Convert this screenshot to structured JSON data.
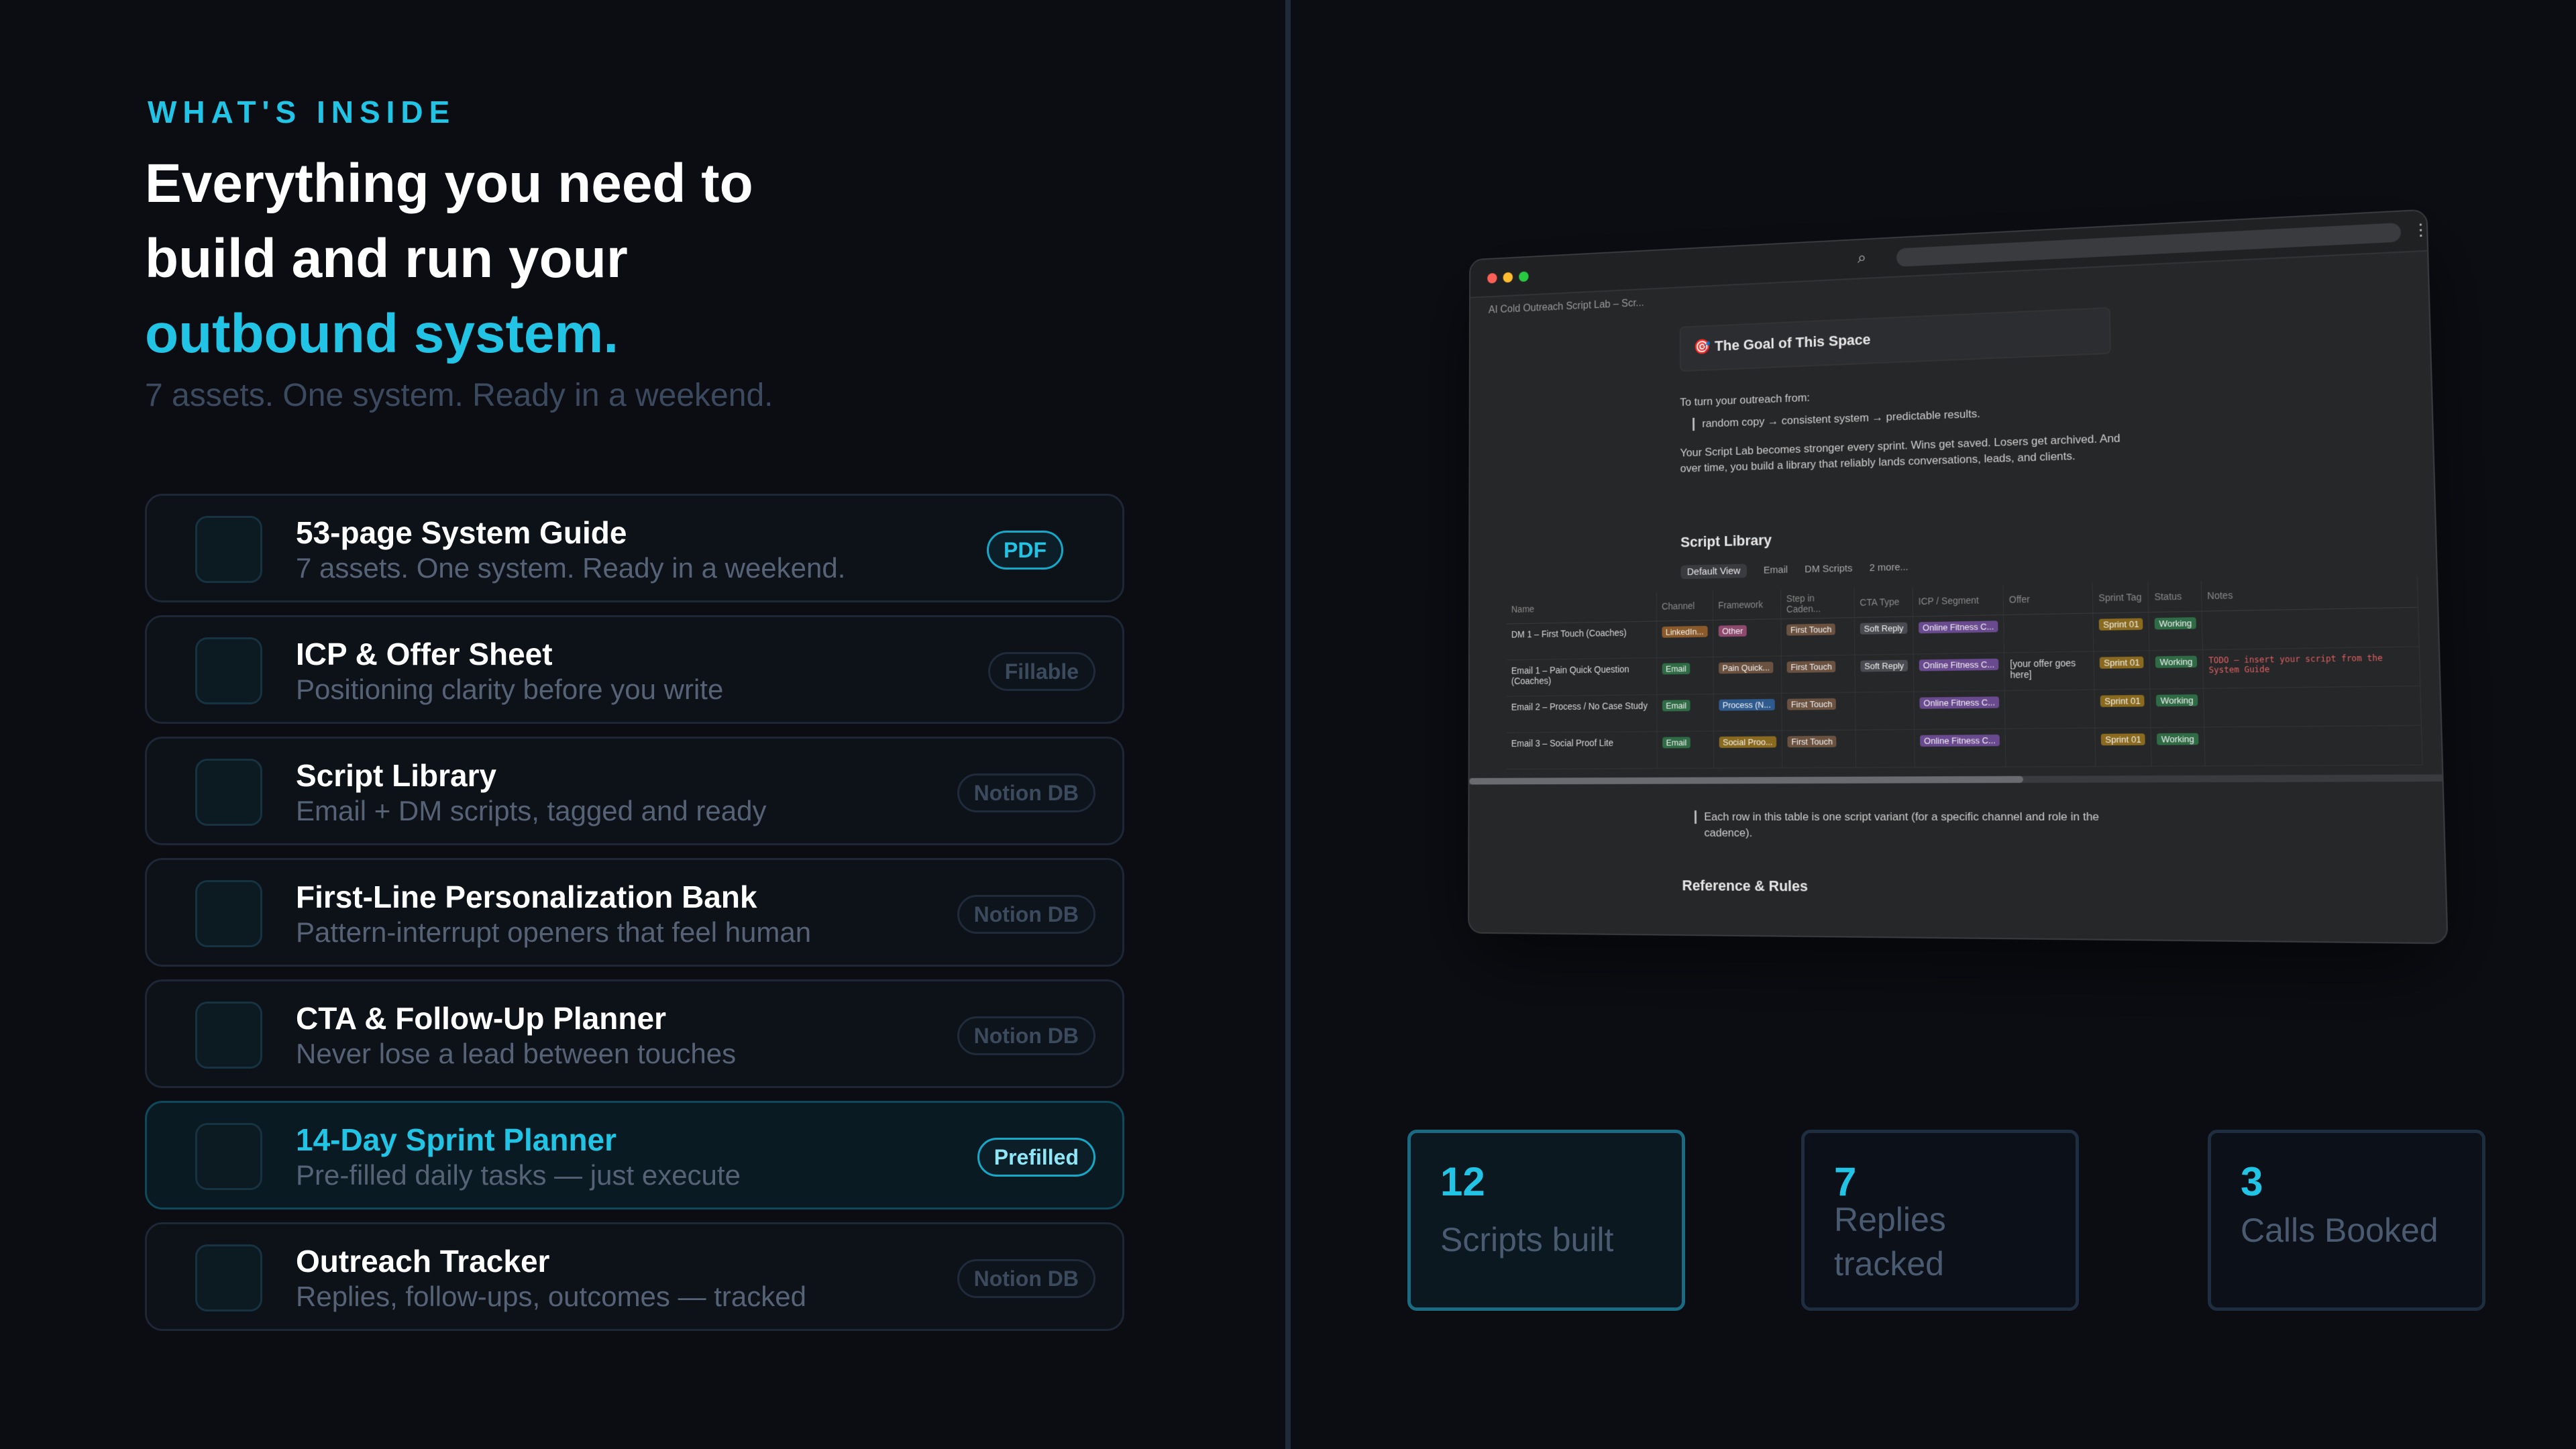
{
  "hero": {
    "eyebrow": "WHAT'S INSIDE",
    "headline_line1": "Everything you need to",
    "headline_line2": "build and run your",
    "headline_accent": "outbound system.",
    "subtitle": "7 assets. One system. Ready in a weekend."
  },
  "assets": [
    {
      "title": "53-page System Guide",
      "desc": "7 assets. One system. Ready in a weekend.",
      "badge": "PDF"
    },
    {
      "title": "ICP & Offer Sheet",
      "desc": "Positioning clarity before you write",
      "badge": "Fillable"
    },
    {
      "title": "Script Library",
      "desc": "Email + DM scripts, tagged and ready",
      "badge": "Notion DB"
    },
    {
      "title": "First-Line Personalization Bank",
      "desc": "Pattern-interrupt openers that feel human",
      "badge": "Notion DB"
    },
    {
      "title": "CTA & Follow-Up Planner",
      "desc": "Never lose a lead between touches",
      "badge": "Notion DB"
    },
    {
      "title": "14-Day Sprint Planner",
      "desc": "Pre-filled daily tasks — just execute",
      "badge": "Prefilled"
    },
    {
      "title": "Outreach Tracker",
      "desc": "Replies, follow-ups, outcomes — tracked",
      "badge": "Notion DB"
    }
  ],
  "window": {
    "tab_label": "AI Cold Outreach Script Lab – Scr...",
    "callout_title": "🎯 The Goal of This Space",
    "intro": "To turn your outreach from:",
    "quote": "random copy → consistent system → predictable results.",
    "para_line1": "Your Script Lab becomes stronger every sprint. Wins get saved. Losers get archived. And",
    "para_line2": "over time, you build a library that reliably lands conversations, leads, and clients.",
    "library_heading": "Script Library",
    "views": {
      "default": "Default View",
      "email": "Email",
      "dm": "DM Scripts",
      "more": "2 more..."
    },
    "columns": [
      "Name",
      "Channel",
      "Framework",
      "Step in Caden...",
      "CTA Type",
      "ICP / Segment",
      "Offer",
      "Sprint Tag",
      "Status",
      "Notes"
    ],
    "rows": [
      {
        "name": "DM 1 – First Touch (Coaches)",
        "channel": "LinkedIn...",
        "framework": "Other",
        "step": "First Touch",
        "cta": "Soft Reply",
        "icp": "Online Fitness C...",
        "offer": "",
        "sprint": "Sprint 01",
        "status": "Working",
        "notes": ""
      },
      {
        "name": "Email 1 – Pain Quick Question (Coaches)",
        "channel": "Email",
        "framework": "Pain Quick...",
        "step": "First Touch",
        "cta": "Soft Reply",
        "icp": "Online Fitness C...",
        "offer": "[your offer goes here]",
        "sprint": "Sprint 01",
        "status": "Working",
        "notes": "TODO – insert your script from the System Guide"
      },
      {
        "name": "Email 2 – Process / No Case Study",
        "channel": "Email",
        "framework": "Process (N...",
        "step": "First Touch",
        "cta": "",
        "icp": "Online Fitness C...",
        "offer": "",
        "sprint": "Sprint 01",
        "status": "Working",
        "notes": ""
      },
      {
        "name": "Email 3 – Social Proof Lite",
        "channel": "Email",
        "framework": "Social Proo...",
        "step": "First Touch",
        "cta": "",
        "icp": "Online Fitness C...",
        "offer": "",
        "sprint": "Sprint 01",
        "status": "Working",
        "notes": ""
      }
    ],
    "footnote_line1": "Each row in this table is one script variant (for a specific channel and role in the",
    "footnote_line2": "cadence).",
    "reference_heading": "Reference & Rules"
  },
  "stats": [
    {
      "value": "12",
      "label": "Scripts built"
    },
    {
      "value": "7",
      "label": "Replies tracked"
    },
    {
      "value": "3",
      "label": "Calls Booked"
    }
  ],
  "colors": {
    "accent": "#22c4e6",
    "background": "#0b0d13",
    "tag_orange": "#8a5a2b",
    "tag_pink": "#8e4a6e",
    "tag_brown": "#6b5240",
    "tag_green": "#2f6b45",
    "tag_blue": "#2f5a8e",
    "tag_purple": "#6a4a8e",
    "tag_yellow": "#8a6a1e",
    "tag_gray": "#4a4b50"
  }
}
